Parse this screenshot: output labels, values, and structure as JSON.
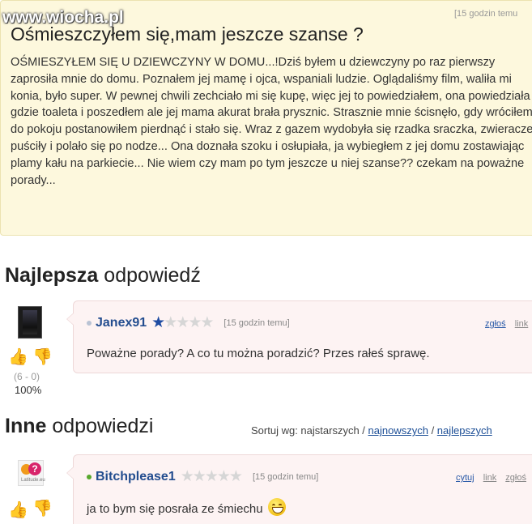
{
  "watermark": "www.wiocha.pl",
  "question": {
    "time": "[15 godzin temu",
    "title": "Ośmieszczyłem się,mam jeszcze szanse ?",
    "body": "OŚMIESZYŁEM SIĘ U DZIEWCZYNY W DOMU...!Dziś byłem u dziewczyny po raz pierwszy zaprosiła mnie do domu. Poznałem jej mamę i ojca, wspaniali ludzie. Oglądaliśmy film, waliła mi konia, było super. W pewnej chwili zechciało mi się kupę, więc jej to powiedziałem, ona powiedziała gdzie toaleta i poszedłem ale jej mama akurat brała prysznic. Strasznie mnie ścisnęło, gdy wróciłem do pokoju postanowiłem pierdnąć i stało się. Wraz z gazem wydobyła się rzadka sraczka, zwieracze puściły i polało się po nodze... Ona doznała szoku i osłupiała, ja wybiegłem z jej domu zostawiając plamy kału na parkiecie... Nie wiem czy mam po tym jeszcze u niej szanse?? czekam na poważne porady..."
  },
  "best_answer": {
    "heading_bold": "Najlepsza",
    "heading_rest": " odpowiedź",
    "username": "Janex91",
    "rating": 1,
    "max_rating": 5,
    "time": "[15 godzin temu]",
    "actions": [
      "zgłoś",
      "link"
    ],
    "text": "Poważne porady? A co tu można poradzić? Przes rałeś sprawę.",
    "votes": "(6 - 0)",
    "percent": "100%",
    "avatar_icon": "user-avatar-dark"
  },
  "other_answers": {
    "heading_bold": "Inne",
    "heading_rest": " odpowiedzi",
    "sort": {
      "label": "Sortuj wg: ",
      "current": "najstarszych",
      "sep1": " / ",
      "option2": "najnowszych",
      "sep2": " / ",
      "option3": "najlepszych"
    },
    "items": [
      {
        "username": "Bitchplease1",
        "rating": 0,
        "max_rating": 5,
        "time": "[15 godzin temu]",
        "actions": [
          "cytuj",
          "link",
          "zgłoś"
        ],
        "text": "ja to bym się posrała ze śmiechu",
        "emoji": "laughing-face-icon",
        "avatar_icon": "user-avatar-logo",
        "avatar_caption": "Latitude.eu"
      }
    ]
  },
  "colors": {
    "question_bg": "#fdf8dd",
    "answer_bg": "#fdf3f3",
    "username": "#234d8f",
    "star_on": "#1e4ba2",
    "star_off": "#d6d6d6",
    "thumb_up": "#b43fb5",
    "thumb_down": "#e8b21a",
    "online": "#58a82d"
  }
}
